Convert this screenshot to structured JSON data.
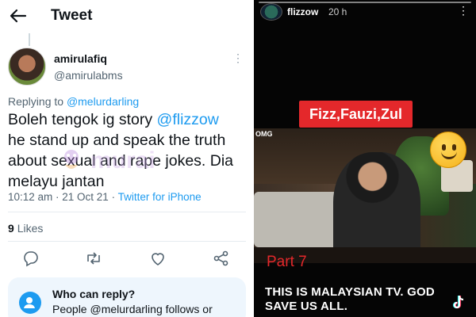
{
  "tweet_panel": {
    "header_title": "Tweet",
    "author": {
      "name": "amirulafiq",
      "handle": "@amirulabms"
    },
    "replying": {
      "prefix": "Replying to",
      "mention": "@melurdarling"
    },
    "text": {
      "line1": "Boleh tengok ig story ",
      "mention": "@flizzow",
      "line2": "he stand up and speak the truth",
      "line3": "about sexual and rape jokes. Dia",
      "line4": "melayu jantan"
    },
    "meta": {
      "timestamp": "10:12 am · 21 Oct 21 · ",
      "source": "Twitter for iPhone"
    },
    "likes": {
      "count": "9",
      "label": "Likes"
    },
    "reply_settings": {
      "title": "Who can reply?",
      "subtitle": "People @melurdarling follows or"
    },
    "watermark_text": "murai",
    "icons": [
      "back-arrow-icon",
      "more-icon",
      "reply-icon",
      "retweet-icon",
      "like-icon",
      "share-icon",
      "person-icon"
    ]
  },
  "story_panel": {
    "username": "flizzow",
    "time": "20 h",
    "overlay_label": "Fizz,Fauzi,Zul",
    "channel_tag": "OMG",
    "part": "Part 7",
    "caption": "THIS IS MALAYSIAN TV. GOD SAVE US ALL.",
    "icons": [
      "more-icon",
      "smile-emoji-icon",
      "tiktok-logo-icon"
    ],
    "colors": {
      "label_red": "#e4282b",
      "link_blue": "#1d9bf0"
    }
  }
}
